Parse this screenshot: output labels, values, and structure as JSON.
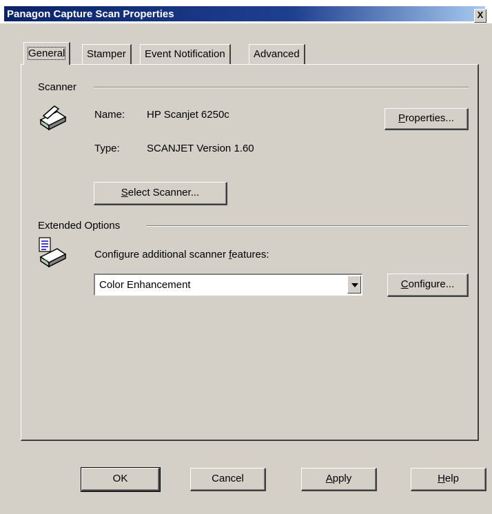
{
  "window": {
    "title": "Panagon Capture Scan Properties",
    "close_label": "X"
  },
  "tabs": [
    {
      "label": "General",
      "active": true
    },
    {
      "label": "Stamper",
      "active": false
    },
    {
      "label": "Event Notification",
      "active": false
    },
    {
      "label": "Advanced",
      "active": false
    }
  ],
  "scanner": {
    "group_title": "Scanner",
    "name_label": "Name:",
    "name_value": "HP Scanjet 6250c",
    "type_label": "Type:",
    "type_value": "SCANJET Version 1.60",
    "properties_button": {
      "mnemonic": "P",
      "rest": "roperties..."
    },
    "select_button": {
      "mnemonic": "S",
      "rest": "elect Scanner..."
    }
  },
  "extended": {
    "group_title": "Extended Options",
    "description_pre": "Configure additional scanner ",
    "description_mnemonic": "f",
    "description_post": "eatures:",
    "selected_option": "Color Enhancement",
    "configure_button": {
      "mnemonic": "C",
      "rest": "onfigure..."
    }
  },
  "footer": {
    "ok_label": "OK",
    "cancel_label": "Cancel",
    "apply_button": {
      "mnemonic": "A",
      "rest": "pply"
    },
    "help_button": {
      "mnemonic": "H",
      "rest": "elp"
    }
  },
  "icons": {
    "scanner": "scanner-icon",
    "scanner_document": "scanner-document-icon"
  }
}
